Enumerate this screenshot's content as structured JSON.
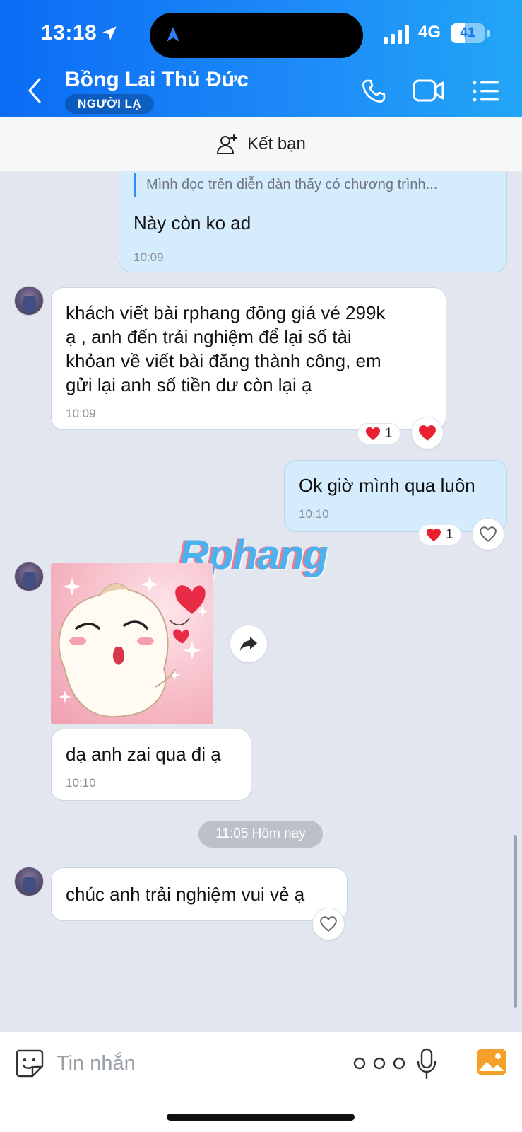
{
  "status_bar": {
    "time": "13:18",
    "network": "4G",
    "battery": "41",
    "battery_level_percent": 41
  },
  "header": {
    "contact_name": "Bồng Lai Thủ Đức",
    "badge": "NGƯỜI LẠ"
  },
  "friend_bar": {
    "label": "Kết bạn"
  },
  "messages": [
    {
      "side": "out",
      "quote": "Mình đọc trên diễn đàn thấy có chương trình...",
      "text": "Này còn ko ad",
      "time": "10:09"
    },
    {
      "side": "in",
      "lines": [
        "khách viết bài rphang đông giá vé 299k",
        "ạ , anh đến trải nghiệm để lại số tài",
        "khỏan về viết bài đăng thành công,  em",
        "gửi lại anh số tiền dư còn lại ạ"
      ],
      "time": "10:09",
      "reaction_count": "1"
    },
    {
      "side": "out",
      "text": "Ok giờ mình qua luôn",
      "time": "10:10",
      "reaction_count": "1"
    },
    {
      "side": "in",
      "type": "sticker"
    },
    {
      "side": "in",
      "text": "dạ anh zai qua đi ạ",
      "time": "10:10"
    },
    {
      "side": "in",
      "text": "chúc anh trải nghiệm vui vẻ ạ"
    }
  ],
  "date_divider": "11:05 Hôm nay",
  "watermark": "Rphang",
  "input": {
    "placeholder": "Tin nhắn"
  },
  "colors": {
    "header_start": "#0a6cf5",
    "header_end": "#22a6f6",
    "out_bubble": "#d5ecfd",
    "in_bubble": "#ffffff",
    "chat_bg": "#e2e7ef",
    "heart": "#e8202f",
    "image_icon": "#f5a02a"
  }
}
